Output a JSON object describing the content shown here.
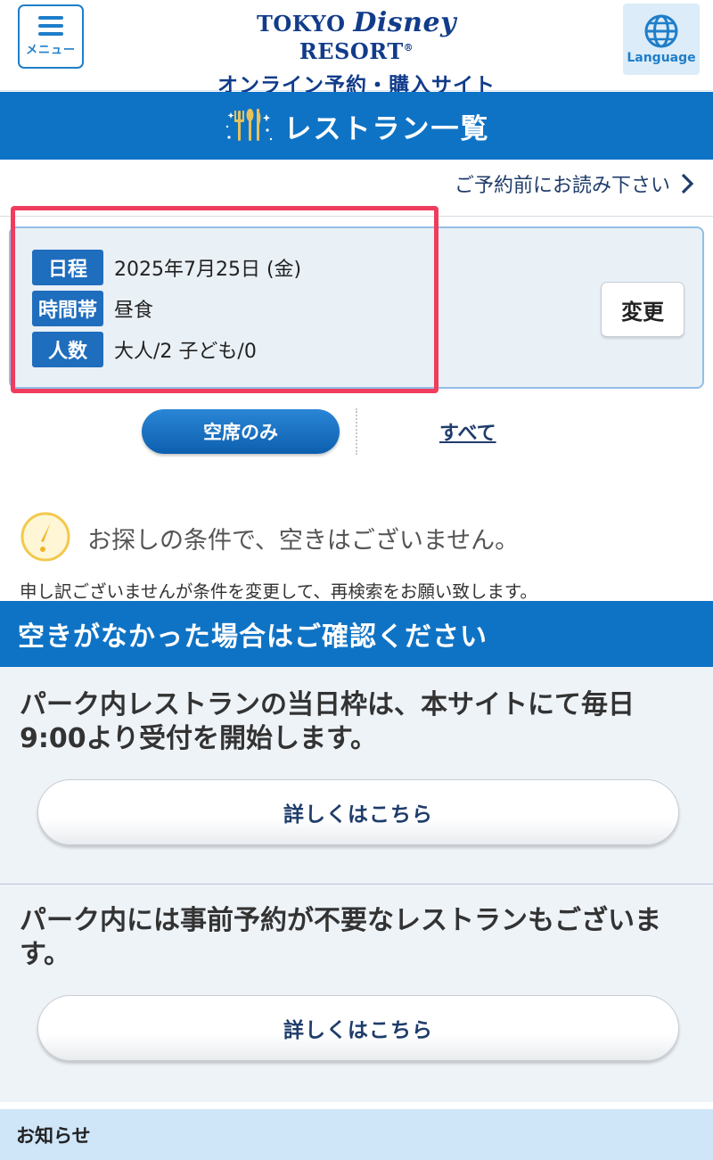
{
  "header": {
    "menu_label": "メニュー",
    "logo_left": "TOKYO",
    "logo_script": "Disney",
    "logo_right": "RESORT",
    "logo_mark": "®",
    "site_name": "オンライン予約・購入サイト",
    "language_label": "Language"
  },
  "page": {
    "title": "レストラン一覧",
    "pre_note": "ご予約前にお読み下さい"
  },
  "conditions": {
    "rows": [
      {
        "label": "日程",
        "value": "2025年7月25日 (金)"
      },
      {
        "label": "時間帯",
        "value": "昼食"
      },
      {
        "label": "人数",
        "value": "大人/2 子ども/0"
      }
    ],
    "change_label": "変更"
  },
  "filter": {
    "active_label": "空席のみ",
    "other_label": "すべて"
  },
  "notice": {
    "message": "お探しの条件で、空きはございません。",
    "sub": "申し訳ございませんが条件を変更して、再検索をお願い致します。"
  },
  "section": {
    "title": "空きがなかった場合はご確認ください",
    "blocks": [
      {
        "text": "パーク内レストランの当日枠は、本サイトにて毎日9:00より受付を開始します。",
        "button": "詳しくはこちら"
      },
      {
        "text": "パーク内には事前予約が不要なレストランもございます。",
        "button": "詳しくはこちら"
      }
    ]
  },
  "news": {
    "title": "お知らせ"
  },
  "colors": {
    "brand_blue": "#0f73c5",
    "navy": "#123c8a",
    "highlight_red": "#f03c5d"
  }
}
